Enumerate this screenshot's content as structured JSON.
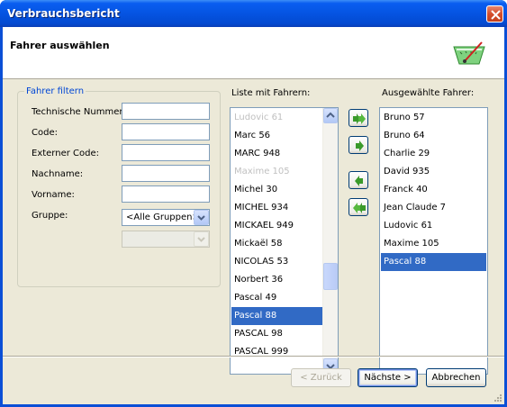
{
  "window": {
    "title": "Verbrauchsbericht"
  },
  "header": {
    "title": "Fahrer auswählen"
  },
  "filter": {
    "group_label": "Fahrer filtern",
    "fields": [
      {
        "label": "Technische Nummer:",
        "value": ""
      },
      {
        "label": "Code:",
        "value": ""
      },
      {
        "label": "Externer Code:",
        "value": ""
      },
      {
        "label": "Nachname:",
        "value": ""
      },
      {
        "label": "Vorname:",
        "value": ""
      }
    ],
    "gruppe_label": "Gruppe:",
    "gruppe_value": "<Alle Gruppen>",
    "sub_value": ""
  },
  "available": {
    "label": "Liste mit Fahrern:",
    "items": [
      {
        "text": "Ludovic 61",
        "state": "grey"
      },
      {
        "text": "Marc 56",
        "state": ""
      },
      {
        "text": "MARC 948",
        "state": ""
      },
      {
        "text": "Maxime 105",
        "state": "grey"
      },
      {
        "text": "Michel 30",
        "state": ""
      },
      {
        "text": "MICHEL 934",
        "state": ""
      },
      {
        "text": "MICKAEL 949",
        "state": ""
      },
      {
        "text": "Mickaël 58",
        "state": ""
      },
      {
        "text": "NICOLAS 53",
        "state": ""
      },
      {
        "text": "Norbert 36",
        "state": ""
      },
      {
        "text": "Pascal 49",
        "state": ""
      },
      {
        "text": "Pascal 88",
        "state": "sel"
      },
      {
        "text": "PASCAL 98",
        "state": ""
      },
      {
        "text": "PASCAL 999",
        "state": ""
      }
    ]
  },
  "selected": {
    "label": "Ausgewählte Fahrer:",
    "items": [
      {
        "text": "Bruno 57",
        "state": ""
      },
      {
        "text": "Bruno 64",
        "state": ""
      },
      {
        "text": "Charlie 29",
        "state": ""
      },
      {
        "text": "David 935",
        "state": ""
      },
      {
        "text": "Franck 40",
        "state": ""
      },
      {
        "text": "Jean Claude 7",
        "state": ""
      },
      {
        "text": "Ludovic 61",
        "state": ""
      },
      {
        "text": "Maxime 105",
        "state": ""
      },
      {
        "text": "Pascal 88",
        "state": "sel"
      }
    ]
  },
  "buttons": {
    "back": "< Zurück",
    "next": "Nächste >",
    "cancel": "Abbrechen"
  },
  "colors": {
    "title_bar": "#0554e2",
    "selection": "#316ac5",
    "group_label": "#0046d5"
  },
  "icons": {
    "close": "close-icon",
    "gauge": "gauge-icon",
    "add_all": "double-arrow-right-icon",
    "add": "arrow-right-icon",
    "remove": "arrow-left-icon",
    "remove_all": "double-arrow-left-icon"
  }
}
